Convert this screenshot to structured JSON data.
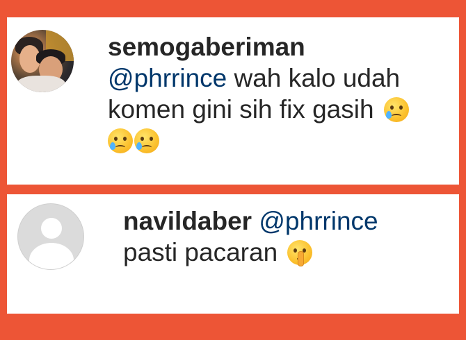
{
  "comments": [
    {
      "username": "semogaberiman",
      "mention": "@phrrince",
      "text_line1": " wah kalo udah",
      "text_line2": "komen gini sih fix gasih",
      "emojis": [
        "smiling-face-with-tear",
        "smiling-face-with-tear",
        "smiling-face-with-tear"
      ],
      "avatar": "user-photo"
    },
    {
      "username": "navildaber",
      "mention": "@phrrince",
      "text": "pasti pacaran",
      "emojis": [
        "shushing-face"
      ],
      "avatar": "default-avatar-icon"
    }
  ],
  "colors": {
    "background": "#ed5536",
    "card": "#ffffff",
    "text": "#262626",
    "mention": "#00376b"
  }
}
